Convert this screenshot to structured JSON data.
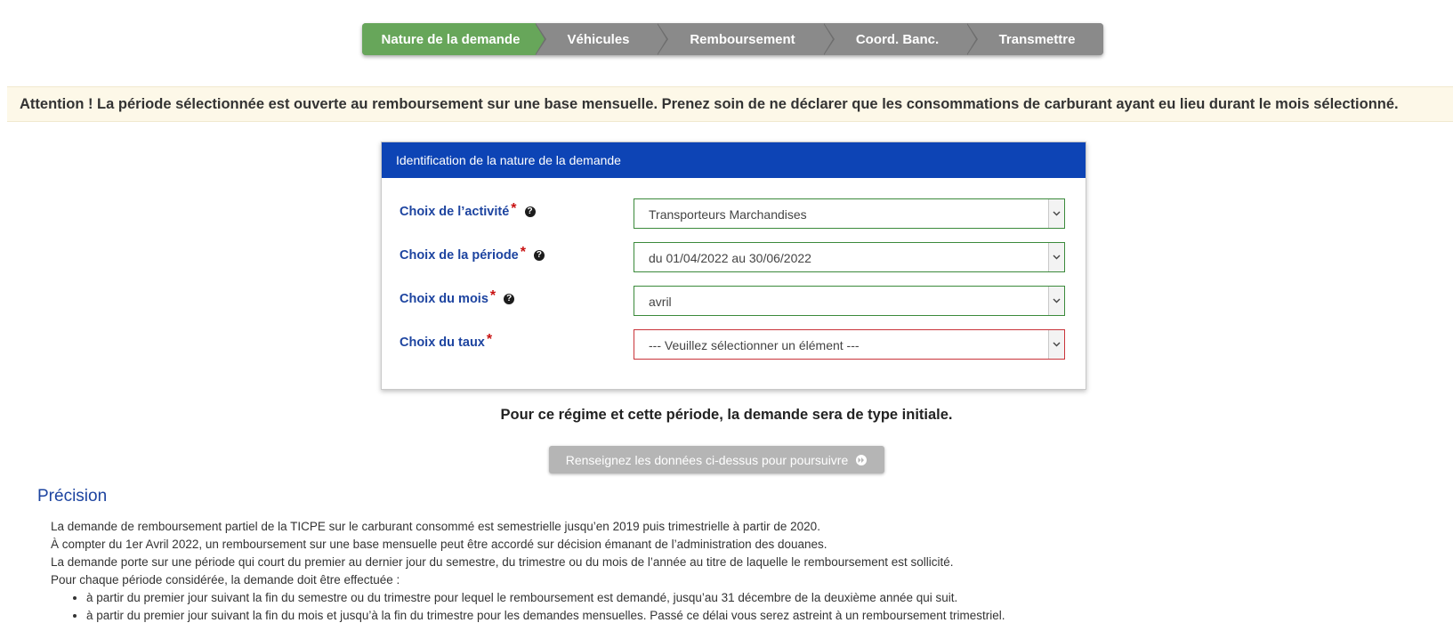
{
  "stepper": {
    "steps": [
      {
        "label": "Nature de la demande",
        "state": "active"
      },
      {
        "label": "Véhicules",
        "state": "inactive"
      },
      {
        "label": "Remboursement",
        "state": "inactive"
      },
      {
        "label": "Coord. Banc.",
        "state": "inactive"
      },
      {
        "label": "Transmettre",
        "state": "inactive"
      }
    ],
    "active_color": "#67a65a",
    "inactive_color": "#8a8a8a"
  },
  "alert": {
    "text": "Attention ! La période sélectionnée est ouverte au remboursement sur une base mensuelle. Prenez soin de ne déclarer que les consommations de carburant ayant eu lieu durant le mois sélectionné."
  },
  "panel": {
    "header": "Identification de la nature de la demande",
    "header_color": "#0d44b5",
    "fields": [
      {
        "label": "Choix de l’activité",
        "required": "*",
        "help": "?",
        "value": "Transporteurs Marchandises",
        "state": "valid"
      },
      {
        "label": "Choix de la période",
        "required": "*",
        "help": "?",
        "value": "du 01/04/2022 au 30/06/2022",
        "state": "valid"
      },
      {
        "label": "Choix du mois",
        "required": "*",
        "help": "?",
        "value": "avril",
        "state": "valid"
      },
      {
        "label": "Choix du taux",
        "required": "*",
        "value": "--- Veuillez sélectionner un élément ---",
        "state": "invalid"
      }
    ]
  },
  "info": {
    "text": "Pour ce régime et cette période, la demande sera de type initiale."
  },
  "continue_button": {
    "label": "Renseignez les données ci-dessus pour poursuivre",
    "icon": "fast-forward-icon"
  },
  "precision": {
    "title": "Précision",
    "paragraphs": [
      "La demande de remboursement partiel de la TICPE sur le carburant consommé est semestrielle jusqu’en 2019 puis trimestrielle à partir de 2020.",
      "À compter du 1er Avril 2022, un remboursement sur une base mensuelle peut être accordé sur décision émanant de l’administration des douanes.",
      "La demande porte sur une période qui court du premier au dernier jour du semestre, du trimestre ou du mois de l’année au titre de laquelle le remboursement est sollicité.",
      "Pour chaque période considérée, la demande doit être effectuée :"
    ],
    "bullets": [
      "à partir du premier jour suivant la fin du semestre ou du trimestre pour lequel le remboursement est demandé, jusqu’au 31 décembre de la deuxième année qui suit.",
      "à partir du premier jour suivant la fin du mois et jusqu’à la fin du trimestre pour les demandes mensuelles. Passé ce délai vous serez astreint à un remboursement trimestriel."
    ]
  }
}
